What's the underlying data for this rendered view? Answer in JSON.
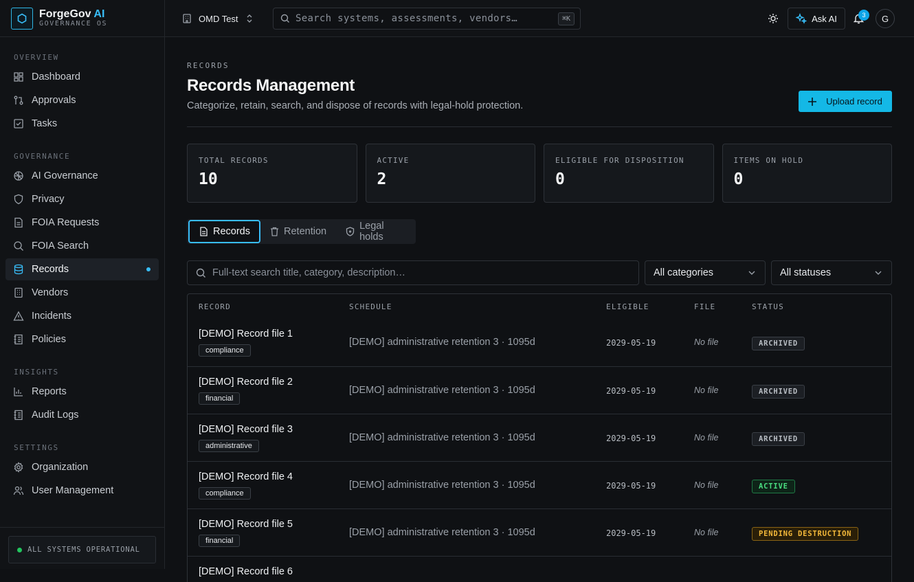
{
  "brand": {
    "name": "ForgeGov",
    "name_accent": "AI",
    "subtitle": "GOVERNANCE OS"
  },
  "sidebar": {
    "sections": [
      {
        "heading": "OVERVIEW",
        "items": [
          {
            "label": "Dashboard",
            "icon": "dashboard-icon"
          },
          {
            "label": "Approvals",
            "icon": "approvals-icon"
          },
          {
            "label": "Tasks",
            "icon": "tasks-icon"
          }
        ]
      },
      {
        "heading": "GOVERNANCE",
        "items": [
          {
            "label": "AI Governance",
            "icon": "brain-icon"
          },
          {
            "label": "Privacy",
            "icon": "shield-icon"
          },
          {
            "label": "FOIA Requests",
            "icon": "document-icon"
          },
          {
            "label": "FOIA Search",
            "icon": "search-icon"
          },
          {
            "label": "Records",
            "icon": "database-icon",
            "active": true
          },
          {
            "label": "Vendors",
            "icon": "building-icon"
          },
          {
            "label": "Incidents",
            "icon": "warning-icon"
          },
          {
            "label": "Policies",
            "icon": "policy-icon"
          }
        ]
      },
      {
        "heading": "INSIGHTS",
        "items": [
          {
            "label": "Reports",
            "icon": "bar-chart-icon"
          },
          {
            "label": "Audit Logs",
            "icon": "logs-icon"
          }
        ]
      },
      {
        "heading": "SETTINGS",
        "items": [
          {
            "label": "Organization",
            "icon": "gear-icon"
          },
          {
            "label": "User Management",
            "icon": "users-icon"
          }
        ]
      }
    ],
    "status": "ALL SYSTEMS OPERATIONAL"
  },
  "topbar": {
    "org": "OMD Test",
    "search_placeholder": "Search systems, assessments, vendors…",
    "shortcut": "⌘K",
    "ask_ai": "Ask AI",
    "notification_count": "3",
    "avatar_initial": "G"
  },
  "page": {
    "eyebrow": "RECORDS",
    "title": "Records Management",
    "subtitle": "Categorize, retain, search, and dispose of records with legal-hold protection.",
    "upload_label": "Upload record"
  },
  "stats": [
    {
      "label": "TOTAL RECORDS",
      "value": "10"
    },
    {
      "label": "ACTIVE",
      "value": "2"
    },
    {
      "label": "ELIGIBLE FOR DISPOSITION",
      "value": "0"
    },
    {
      "label": "ITEMS ON HOLD",
      "value": "0"
    }
  ],
  "tabs": [
    {
      "label": "Records",
      "active": true
    },
    {
      "label": "Retention"
    },
    {
      "label": "Legal holds"
    }
  ],
  "filters": {
    "search_placeholder": "Full-text search title, category, description…",
    "category": "All categories",
    "status": "All statuses"
  },
  "table": {
    "headers": [
      "RECORD",
      "SCHEDULE",
      "ELIGIBLE",
      "FILE",
      "STATUS"
    ],
    "rows": [
      {
        "title": "[DEMO] Record file 1",
        "category": "compliance",
        "schedule": "[DEMO] administrative retention 3 · 1095d",
        "eligible": "2029-05-19",
        "file": "No file",
        "status": "ARCHIVED",
        "status_kind": "archived"
      },
      {
        "title": "[DEMO] Record file 2",
        "category": "financial",
        "schedule": "[DEMO] administrative retention 3 · 1095d",
        "eligible": "2029-05-19",
        "file": "No file",
        "status": "ARCHIVED",
        "status_kind": "archived"
      },
      {
        "title": "[DEMO] Record file 3",
        "category": "administrative",
        "schedule": "[DEMO] administrative retention 3 · 1095d",
        "eligible": "2029-05-19",
        "file": "No file",
        "status": "ARCHIVED",
        "status_kind": "archived"
      },
      {
        "title": "[DEMO] Record file 4",
        "category": "compliance",
        "schedule": "[DEMO] administrative retention 3 · 1095d",
        "eligible": "2029-05-19",
        "file": "No file",
        "status": "ACTIVE",
        "status_kind": "active"
      },
      {
        "title": "[DEMO] Record file 5",
        "category": "financial",
        "schedule": "[DEMO] administrative retention 3 · 1095d",
        "eligible": "2029-05-19",
        "file": "No file",
        "status": "PENDING DESTRUCTION",
        "status_kind": "pending"
      },
      {
        "title": "[DEMO] Record file 6",
        "category": "",
        "schedule": "",
        "eligible": "",
        "file": "",
        "status": "",
        "status_kind": ""
      }
    ]
  },
  "colors": {
    "accent": "#38bdf8",
    "button": "#14b8e6",
    "success": "#22c55e",
    "warning": "#f5b93a"
  }
}
